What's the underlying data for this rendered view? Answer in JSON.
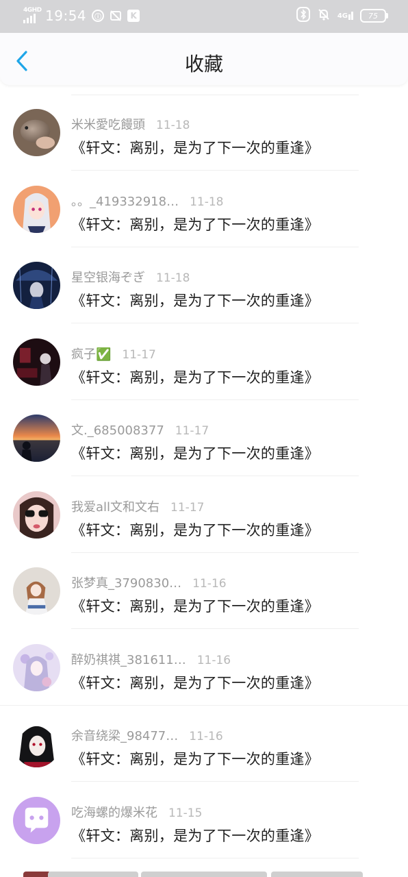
{
  "status_bar": {
    "network_tag": "4GHD",
    "time": "19:54",
    "right_network_tag": "4G",
    "battery": "75"
  },
  "header": {
    "title": "收藏"
  },
  "favorites": [
    {
      "user": "米米愛吃饅頭",
      "date": "11-18",
      "title": "《轩文：离别，是为了下一次的重逢》",
      "avatar": "hamster"
    },
    {
      "user": "。。_419332918…",
      "date": "11-18",
      "title": "《轩文：离别，是为了下一次的重逢》",
      "avatar": "anime-girl-white-hair"
    },
    {
      "user": "星空银海ぞぎ",
      "date": "11-18",
      "title": "《轩文：离别，是为了下一次的重逢》",
      "avatar": "anime-umbrella"
    },
    {
      "user": "疯子✅",
      "date": "11-17",
      "title": "《轩文：离别，是为了下一次的重逢》",
      "avatar": "dark-red-scene"
    },
    {
      "user": "文._685008377",
      "date": "11-17",
      "title": "《轩文：离别，是为了下一次的重逢》",
      "avatar": "sunset-sea"
    },
    {
      "user": "我爱all文和文右",
      "date": "11-17",
      "title": "《轩文：离别，是为了下一次的重逢》",
      "avatar": "sunglasses-girl"
    },
    {
      "user": "张梦真_3790830…",
      "date": "11-16",
      "title": "《轩文：离别，是为了下一次的重逢》",
      "avatar": "anime-sitting"
    },
    {
      "user": "醉奶祺祺_381611…",
      "date": "11-16",
      "title": "《轩文：离别，是为了下一次的重逢》",
      "avatar": "lavender-anime"
    },
    {
      "user": "余音绕梁_98477…",
      "date": "11-16",
      "title": "《轩文：离别，是为了下一次的重逢》",
      "avatar": "black-hair-anime"
    },
    {
      "user": "吃海螺的爆米花",
      "date": "11-15",
      "title": "《轩文：离别，是为了下一次的重逢》",
      "avatar": "chat-bubble-icon"
    }
  ],
  "colors": {
    "accent": "#1fa6e8",
    "status_bar_bg": "#d5d5d7",
    "title_text": "#1f1f1f",
    "meta_text": "#9a9a9a",
    "default_avatar_bg": "#c8a2ee"
  }
}
